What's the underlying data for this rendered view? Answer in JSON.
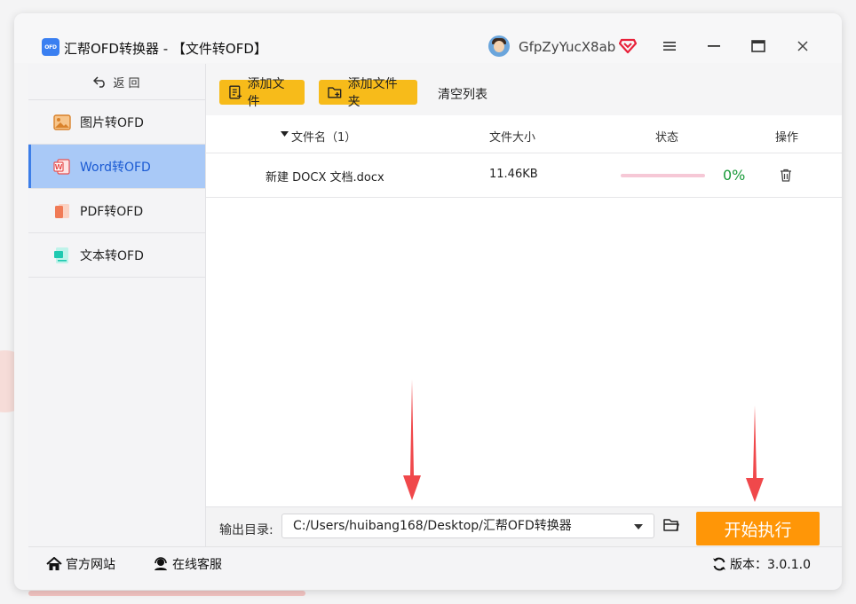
{
  "app": {
    "logo_text": "OFD",
    "title": "汇帮OFD转换器 - 【文件转OFD】"
  },
  "user": {
    "name": "GfpZyYucX8ab"
  },
  "sidebar": {
    "back_label": "返  回",
    "items": [
      {
        "label": "图片转OFD",
        "icon": "image-icon"
      },
      {
        "label": "Word转OFD",
        "icon": "word-icon",
        "active": true
      },
      {
        "label": "PDF转OFD",
        "icon": "pdf-icon"
      },
      {
        "label": "文本转OFD",
        "icon": "text-icon"
      }
    ]
  },
  "toolbar": {
    "add_file": "添加文件",
    "add_folder": "添加文件夹",
    "clear_list": "清空列表"
  },
  "table": {
    "headers": {
      "name": "文件名（1）",
      "size": "文件大小",
      "status": "状态",
      "action": "操作"
    },
    "rows": [
      {
        "name": "新建 DOCX 文档.docx",
        "size": "11.46KB",
        "progress": 0,
        "percent": "0%"
      }
    ]
  },
  "output": {
    "label": "输出目录:",
    "path": "C:/Users/huibang168/Desktop/汇帮OFD转换器",
    "start_label": "开始执行"
  },
  "footer": {
    "website": "官方网站",
    "support": "在线客服",
    "version": "版本：3.0.1.0"
  },
  "colors": {
    "accent": "#3d7ee8",
    "toolbar_button": "#f7bb1a",
    "start_button": "#ff9607",
    "progress_track": "#f6c8d6",
    "success": "#1a9b3a",
    "annotation_arrow": "#f0484b"
  }
}
